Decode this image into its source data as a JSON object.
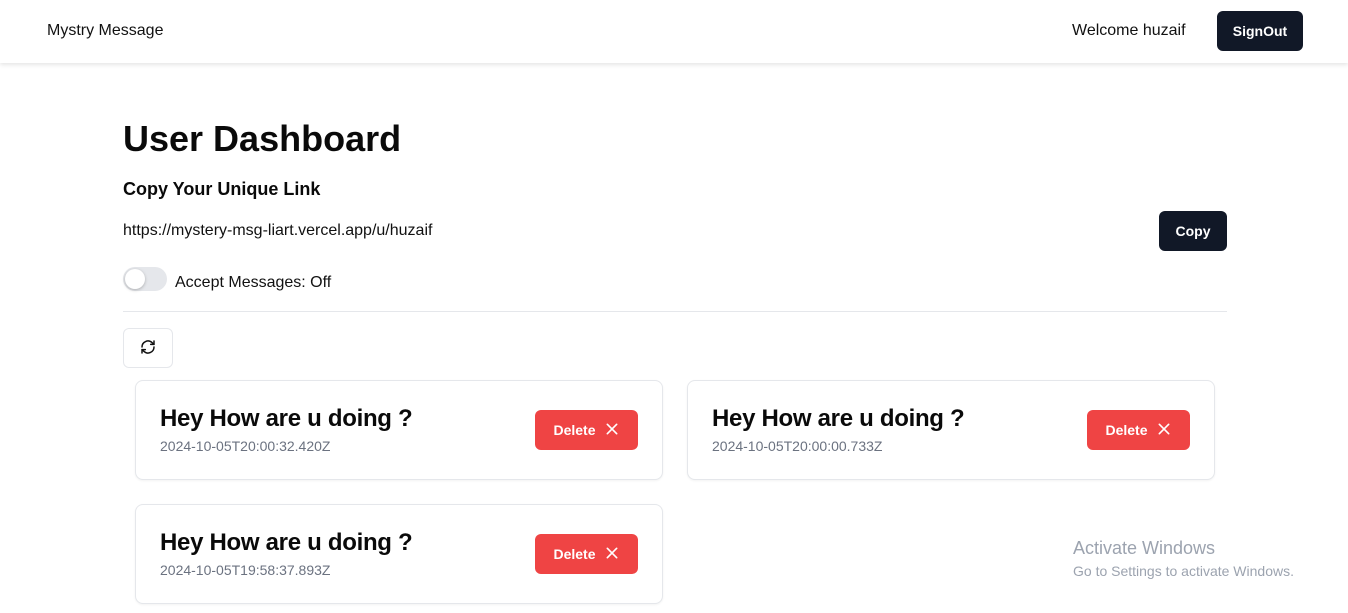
{
  "header": {
    "brand": "Mystry Message",
    "welcome": "Welcome huzaif",
    "signout_label": "SignOut"
  },
  "dashboard": {
    "title": "User Dashboard",
    "copy_heading": "Copy Your Unique Link",
    "unique_link": "https://mystery-msg-liart.vercel.app/u/huzaif",
    "copy_label": "Copy",
    "accept_label": "Accept Messages: Off",
    "accept_messages": false
  },
  "messages": [
    {
      "text": "Hey How are u doing ?",
      "date": "2024-10-05T20:00:32.420Z",
      "delete_label": "Delete"
    },
    {
      "text": "Hey How are u doing ?",
      "date": "2024-10-05T20:00:00.733Z",
      "delete_label": "Delete"
    },
    {
      "text": "Hey How are u doing ?",
      "date": "2024-10-05T19:58:37.893Z",
      "delete_label": "Delete"
    }
  ],
  "watermark": {
    "line1": "Activate Windows",
    "line2": "Go to Settings to activate Windows."
  },
  "colors": {
    "dark_button": "#111827",
    "delete_button": "#ef4444",
    "muted_text": "#6b7280"
  }
}
